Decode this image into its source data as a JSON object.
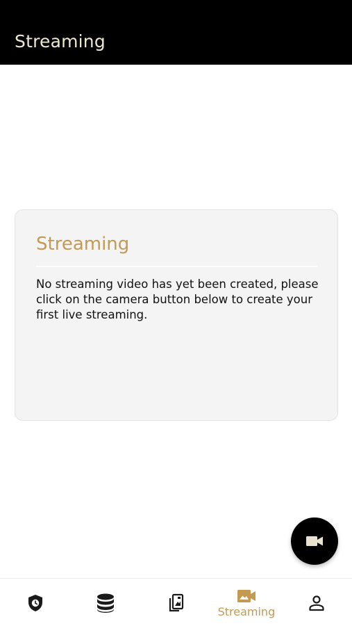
{
  "colors": {
    "accent": "#c49a53",
    "title": "#efe6cf",
    "appbar_bg": "#000000",
    "fab_bg": "#000000",
    "icon_dark": "#1a1a1a"
  },
  "appbar": {
    "title": "Streaming"
  },
  "card": {
    "title": "Streaming",
    "message": "No streaming video has yet been created, please click on the camera button below to create your first live streaming."
  },
  "fab": {
    "icon": "videocam-icon"
  },
  "bottom_nav": {
    "items": [
      {
        "icon": "shield-clock-icon",
        "label": "",
        "active": false
      },
      {
        "icon": "database-icon",
        "label": "",
        "active": false
      },
      {
        "icon": "portrait-cards-icon",
        "label": "",
        "active": false
      },
      {
        "icon": "video-photo-icon",
        "label": "Streaming",
        "active": true
      },
      {
        "icon": "person-icon",
        "label": "",
        "active": false
      }
    ]
  }
}
